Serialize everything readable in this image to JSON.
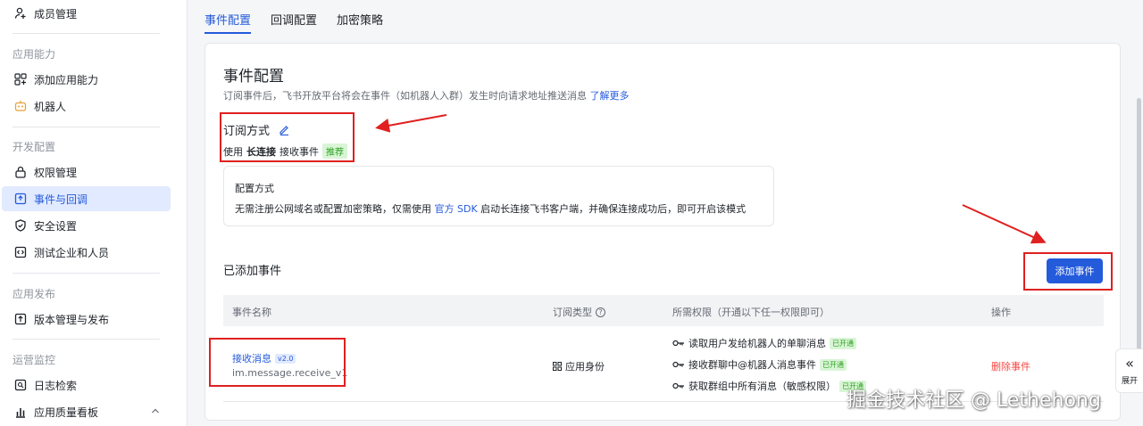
{
  "sidebar": {
    "items": [
      {
        "label": "成员管理",
        "icon": "user-add-icon"
      },
      {
        "label": "添加应用能力",
        "icon": "grid-add-icon"
      },
      {
        "label": "机器人",
        "icon": "robot-icon"
      },
      {
        "label": "权限管理",
        "icon": "lock-icon"
      },
      {
        "label": "事件与回调",
        "icon": "event-icon"
      },
      {
        "label": "安全设置",
        "icon": "shield-icon"
      },
      {
        "label": "测试企业和人员",
        "icon": "code-icon"
      },
      {
        "label": "版本管理与发布",
        "icon": "upload-icon"
      },
      {
        "label": "日志检索",
        "icon": "search-log-icon"
      },
      {
        "label": "应用质量看板",
        "icon": "chart-icon"
      }
    ],
    "groups": [
      "应用能力",
      "开发配置",
      "应用发布",
      "运营监控"
    ]
  },
  "tabs": [
    "事件配置",
    "回调配置",
    "加密策略"
  ],
  "card": {
    "title": "事件配置",
    "desc": "订阅事件后，飞书开放平台将会在事件（如机器人入群）发生时向请求地址推送消息",
    "desc_link": "了解更多"
  },
  "subscription": {
    "title": "订阅方式",
    "line_prefix": "使用",
    "line_bold": "长连接",
    "line_suffix": "接收事件",
    "tag": "推荐"
  },
  "config": {
    "title": "配置方式",
    "text_before": "无需注册公网域名或配置加密策略，仅需使用",
    "link": "官方 SDK",
    "text_after": "启动长连接飞书客户端，并确保连接成功后，即可开启该模式"
  },
  "added": {
    "title": "已添加事件",
    "add_button": "添加事件"
  },
  "table": {
    "headers": [
      "事件名称",
      "订阅类型",
      "所需权限（开通以下任一权限即可）",
      "操作"
    ],
    "row": {
      "name": "接收消息",
      "version": "v2.0",
      "key": "im.message.receive_v1",
      "sub_type": "应用身份",
      "permissions": [
        {
          "text": "读取用户发给机器人的单聊消息",
          "status": "已开通"
        },
        {
          "text": "接收群聊中@机器人消息事件",
          "status": "已开通"
        },
        {
          "text": "获取群组中所有消息（敏感权限）",
          "status": "已开通"
        }
      ],
      "action": "删除事件"
    }
  },
  "expand": {
    "label": "展开"
  },
  "watermark": "掘金技术社区 @ Lethehong",
  "colors": {
    "accent": "#245bdb",
    "danger": "#f54a45",
    "success": "#2ea121",
    "annotation": "#e02020"
  }
}
